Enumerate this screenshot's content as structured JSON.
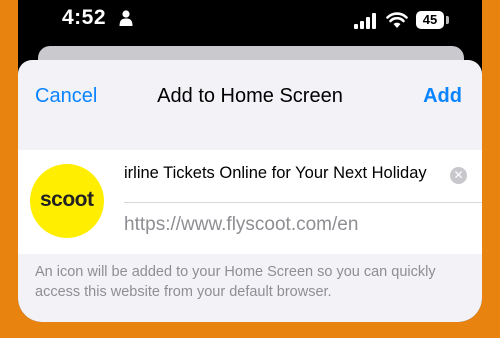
{
  "status_bar": {
    "time": "4:52",
    "battery": "45",
    "icons": [
      "person-icon",
      "cellular-signal-icon",
      "wifi-icon",
      "battery-icon"
    ]
  },
  "sheet": {
    "cancel_label": "Cancel",
    "title": "Add to Home Screen",
    "add_label": "Add",
    "app_icon": {
      "text": "scoot",
      "background": "#ffee00"
    },
    "name_value": "irline Tickets Online for Your Next Holiday",
    "url": "https://www.flyscoot.com/en",
    "footnote": "An icon will be added to your Home Screen so you can quickly access this website from your default browser."
  },
  "colors": {
    "accent": "#0a84ff",
    "page_background": "#e8830f",
    "sheet_background": "#f2f2f7",
    "secondary_text": "#8e8e93"
  }
}
